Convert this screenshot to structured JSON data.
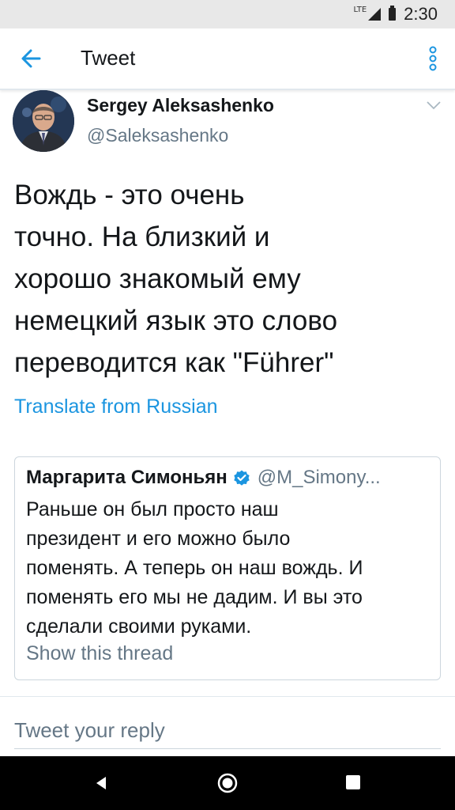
{
  "status_bar": {
    "network": "LTE",
    "time": "2:30"
  },
  "app_bar": {
    "title": "Tweet",
    "back_icon": "arrow-left-icon",
    "overflow_icon": "more-vertical-icon"
  },
  "tweet": {
    "author_name": "Sergey Aleksashenko",
    "author_handle": "@Saleksashenko",
    "text": "Вождь - это очень\nточно. На близкий и\nхорошо знакомый ему\nнемецкий язык это слово\nпереводится как  \"Führer\"",
    "translate_label": "Translate from Russian"
  },
  "quoted_tweet": {
    "author_name": "Маргарита Симоньян",
    "author_handle": "@M_Simony...",
    "verified": true,
    "text": "Раньше он был просто наш\nпрезидент и его можно было\nпоменять. А теперь он наш вождь.  И\nпоменять его мы не дадим. И вы это\nсделали своими руками.",
    "show_thread_label": "Show this thread"
  },
  "reply": {
    "placeholder": "Tweet your reply",
    "value": ""
  },
  "colors": {
    "accent": "#1b95e0",
    "text_primary": "#14171a",
    "text_secondary": "#657786",
    "border": "#ccd6dd"
  }
}
